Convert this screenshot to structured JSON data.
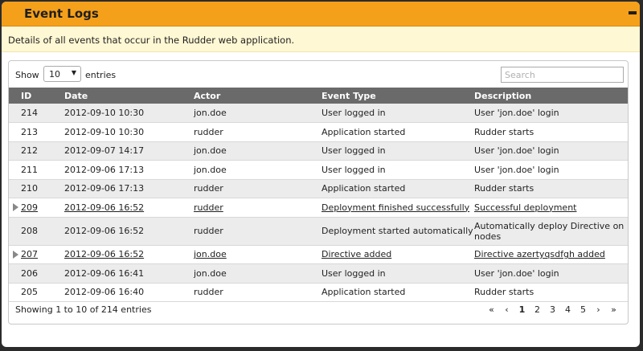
{
  "header": {
    "title": "Event Logs",
    "collapse_icon": "minus-icon"
  },
  "description": "Details of all events that occur in the Rudder web application.",
  "controls": {
    "show_label": "Show",
    "page_size": "10",
    "entries_label": "entries",
    "search_placeholder": "Search"
  },
  "columns": [
    "ID",
    "Date",
    "Actor",
    "Event Type",
    "Description"
  ],
  "rows": [
    {
      "id": "214",
      "date": "2012-09-10 10:30",
      "actor": "jon.doe",
      "type": "User logged in",
      "desc": "User 'jon.doe' login"
    },
    {
      "id": "213",
      "date": "2012-09-10 10:30",
      "actor": "rudder",
      "type": "Application started",
      "desc": "Rudder starts"
    },
    {
      "id": "212",
      "date": "2012-09-07 14:17",
      "actor": "jon.doe",
      "type": "User logged in",
      "desc": "User 'jon.doe' login"
    },
    {
      "id": "211",
      "date": "2012-09-06 17:13",
      "actor": "jon.doe",
      "type": "User logged in",
      "desc": "User 'jon.doe' login"
    },
    {
      "id": "210",
      "date": "2012-09-06 17:13",
      "actor": "rudder",
      "type": "Application started",
      "desc": "Rudder starts"
    },
    {
      "id": "209",
      "date": "2012-09-06 16:52",
      "actor": "rudder",
      "type": "Deployment finished successfully",
      "desc": "Successful deployment",
      "expandable": true
    },
    {
      "id": "208",
      "date": "2012-09-06 16:52",
      "actor": "rudder",
      "type": "Deployment started automatically",
      "desc": "Automatically deploy Directive on nodes"
    },
    {
      "id": "207",
      "date": "2012-09-06 16:52",
      "actor": "jon.doe",
      "type": "Directive added",
      "desc": "Directive azertyqsdfgh added",
      "expandable": true
    },
    {
      "id": "206",
      "date": "2012-09-06 16:41",
      "actor": "jon.doe",
      "type": "User logged in",
      "desc": "User 'jon.doe' login"
    },
    {
      "id": "205",
      "date": "2012-09-06 16:40",
      "actor": "rudder",
      "type": "Application started",
      "desc": "Rudder starts"
    }
  ],
  "footer": {
    "info": "Showing 1 to 10 of 214 entries",
    "pager": {
      "first": "«",
      "prev": "‹",
      "pages": [
        "1",
        "2",
        "3",
        "4",
        "5"
      ],
      "active": "1",
      "next": "›",
      "last": "»"
    }
  }
}
